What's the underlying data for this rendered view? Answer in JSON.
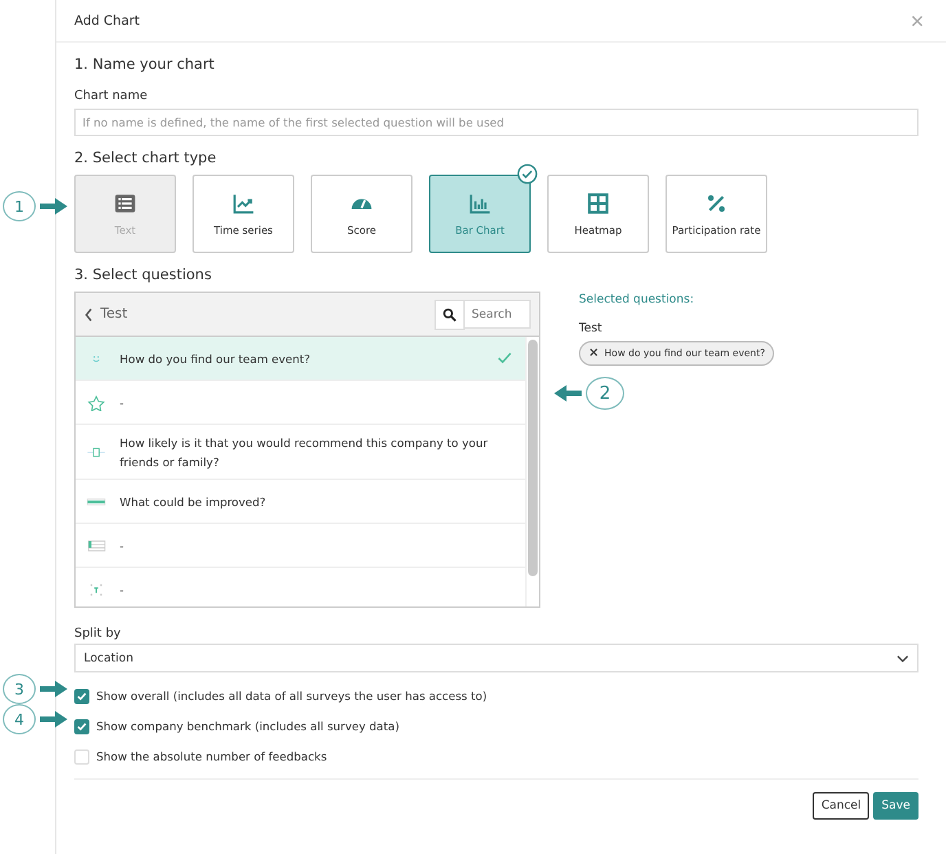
{
  "dialog": {
    "title": "Add Chart",
    "close": "×"
  },
  "name_section": {
    "heading": "1. Name your chart",
    "label": "Chart name",
    "placeholder": "If no name is defined, the name of the first selected question will be used"
  },
  "type_section": {
    "heading": "2. Select chart type",
    "callout": "1",
    "types": [
      {
        "kind": "text",
        "label": "Text",
        "selected": false,
        "disabled": true
      },
      {
        "kind": "timeseries",
        "label": "Time series",
        "selected": false,
        "disabled": false
      },
      {
        "kind": "score",
        "label": "Score",
        "selected": false,
        "disabled": false
      },
      {
        "kind": "bar",
        "label": "Bar Chart",
        "selected": true,
        "disabled": false
      },
      {
        "kind": "heatmap",
        "label": "Heatmap",
        "selected": false,
        "disabled": false
      },
      {
        "kind": "participation",
        "label": "Participation rate",
        "selected": false,
        "disabled": false
      }
    ]
  },
  "question_section": {
    "heading": "3. Select questions",
    "callout": "2",
    "folder": "Test",
    "search_placeholder": "Search",
    "questions": [
      {
        "kind": "smiley",
        "text": "How do you find our team event?",
        "selected": true
      },
      {
        "kind": "star",
        "text": "-",
        "selected": false
      },
      {
        "kind": "slider",
        "text": "How likely is it that you would recommend this company to your friends or family?",
        "selected": false
      },
      {
        "kind": "textfield",
        "text": "What could be improved?",
        "selected": false
      },
      {
        "kind": "list",
        "text": "-",
        "selected": false
      },
      {
        "kind": "matrix",
        "text": "-",
        "selected": false
      }
    ],
    "selected_heading": "Selected questions:",
    "selected_group": "Test",
    "selected_chips": [
      {
        "remove": "×",
        "text": "How do you find our team event?"
      }
    ]
  },
  "split_by": {
    "label": "Split by",
    "value": "Location"
  },
  "options": [
    {
      "label": "Show overall (includes all data of all surveys the user has access to)",
      "checked": true,
      "callout": "3"
    },
    {
      "label": "Show company benchmark (includes all survey data)",
      "checked": true,
      "callout": "4"
    },
    {
      "label": "Show the absolute number of feedbacks",
      "checked": false
    }
  ],
  "buttons": [
    {
      "kind": "secondary",
      "label": "Cancel"
    },
    {
      "kind": "primary",
      "label": "Save"
    }
  ]
}
